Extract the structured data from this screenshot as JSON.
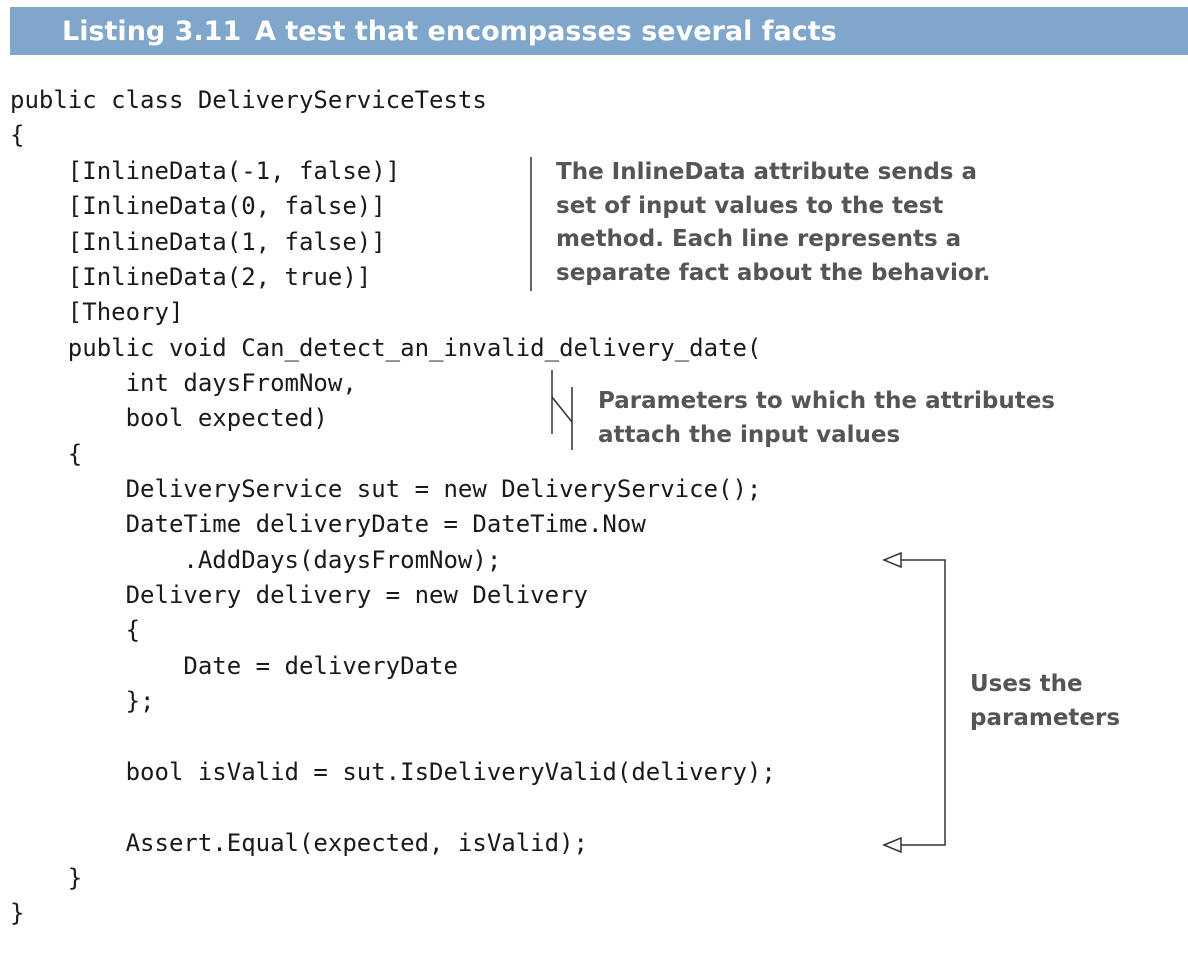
{
  "header": {
    "label": "Listing 3.11",
    "title": "A test that encompasses several facts"
  },
  "code": {
    "lines": [
      "public class DeliveryServiceTests",
      "{",
      "    [InlineData(-1, false)]",
      "    [InlineData(0, false)]",
      "    [InlineData(1, false)]",
      "    [InlineData(2, true)]",
      "    [Theory]",
      "    public void Can_detect_an_invalid_delivery_date(",
      "        int daysFromNow,",
      "        bool expected)",
      "    {",
      "        DeliveryService sut = new DeliveryService();",
      "        DateTime deliveryDate = DateTime.Now",
      "            .AddDays(daysFromNow);",
      "        Delivery delivery = new Delivery",
      "        {",
      "            Date = deliveryDate",
      "        };",
      "        bool isValid = sut.IsDeliveryValid(delivery);",
      "        Assert.Equal(expected, isValid);",
      "    }",
      "}"
    ]
  },
  "annotations": {
    "inline_data": [
      "The InlineData attribute sends a",
      "set of input values to the test",
      "method. Each line represents a",
      "separate fact about the behavior."
    ],
    "parameters": [
      "Parameters to which the attributes",
      "attach the input values"
    ],
    "uses_parameters": [
      "Uses the",
      "parameters"
    ]
  },
  "colors": {
    "header_background": "#7fa6cb",
    "header_text": "#ffffff",
    "code_text": "#1a1a1a",
    "annotation_text": "#555555"
  }
}
